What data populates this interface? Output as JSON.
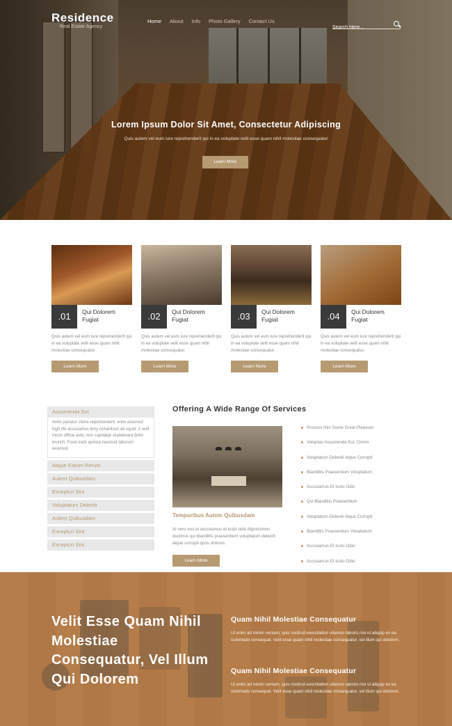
{
  "header": {
    "logo": "Residence",
    "tagline": "Real Estate Agency",
    "nav": [
      "Home",
      "About",
      "Info",
      "Photo Gallery",
      "Contact Us"
    ],
    "search_placeholder": "Search Here..."
  },
  "hero": {
    "title": "Lorem Ipsum Dolor Sit Amet, Consectetur Adipiscing",
    "subtitle": "Quis autem vel eum iure reprehenderit qui in ea voluptate velit esse quam nihil molestiae consequatur",
    "button": "Learn More"
  },
  "features": [
    {
      "num": ".01",
      "title": "Qui Dolorem Fugiat",
      "text": "Quis autem vel eum iure reprehenderit qui in ea voluptate velit esse quam nihil molestiae consequatur.",
      "button": "Learn More"
    },
    {
      "num": ".02",
      "title": "Qui Dolorem Fugiat",
      "text": "Quis autem vel eum iure reprehenderit qui in ea voluptate velit esse quam nihil molestiae consequatur.",
      "button": "Learn More"
    },
    {
      "num": ".03",
      "title": "Qui Dolorem Fugiat",
      "text": "Quis autem vel eum iure reprehenderit qui in ea voluptate velit esse quam nihil molestiae consequatur.",
      "button": "Learn More"
    },
    {
      "num": ".04",
      "title": "Qui Dolorem Fugiat",
      "text": "Quis autem vel eum iure reprehenderit qui in ea voluptate velit esse quam nihil molestiae consequatur.",
      "button": "Learn More"
    }
  ],
  "accordion": {
    "open_title": "Assumenda Est",
    "open_text": "Anim pariatur cliche reprehenderit, enim eiusmod high life accusamus terry richardson ad squid. 3 wolf moon officia aute, non cupidatat skateboard dolor brunch. Food truck quinoa nesciunt laborum eiusmod.",
    "items": [
      "Itaque Earum Rerum",
      "Autem Quibusdam",
      "Excepturi Sint",
      "Voluptatum Deleniti",
      "Autem Quibusdam",
      "Excepturi Sint",
      "Excepturi Sint"
    ]
  },
  "services": {
    "title": "Offering A Wide Range Of Services",
    "subheading": "Temporibus Autem Quibusdam",
    "text": "At vero eos et accusamus et iusto odio dignissimos ducimus qui blanditiis praesentium voluptatum deleniti atque corrupti quos dolores.",
    "button": "Learn More",
    "list": [
      "Process Him Some Great Pleasure",
      "Voluptas Assumenda Est, Omnis",
      "Voluptatum Deleniti Atque Corrupti",
      "Blanditiis Praesentium Voluptatum",
      "Accusamus Et Iusto Odio",
      "Qui Blanditiis Praesentium",
      "Voluptatum Deleniti Atque Corrupti",
      "Blanditiis Praesentium Voluptatum",
      "Accusamus Et Iusto Odio",
      "Accusamus Et Iusto Odio"
    ]
  },
  "bottom": {
    "big_title": "Velit Esse Quam Nihil Molestiae Consequatur, Vel Illum Qui Dolorem",
    "blocks": [
      {
        "heading": "Quam Nihil Molestiae Consequatur",
        "text": "Ut enim ad minim veniam, quis nostrud exercitation ullamco laboris nisi ut aliquip ex ea commodo consequat. Velit esse quam nihil molestiae consequatur, vel illum qui dolorem."
      },
      {
        "heading": "Quam Nihil Molestiae Consequatur",
        "text": "Ut enim ad minim veniam, quis nostrud exercitation ullamco laboris nisi ut aliquip ex ea commodo consequat. Velit esse quam nihil molestiae consequatur, vel illum qui dolorem."
      }
    ]
  },
  "colors": {
    "accent": "#b69a72",
    "dark": "#3a3a3a"
  }
}
